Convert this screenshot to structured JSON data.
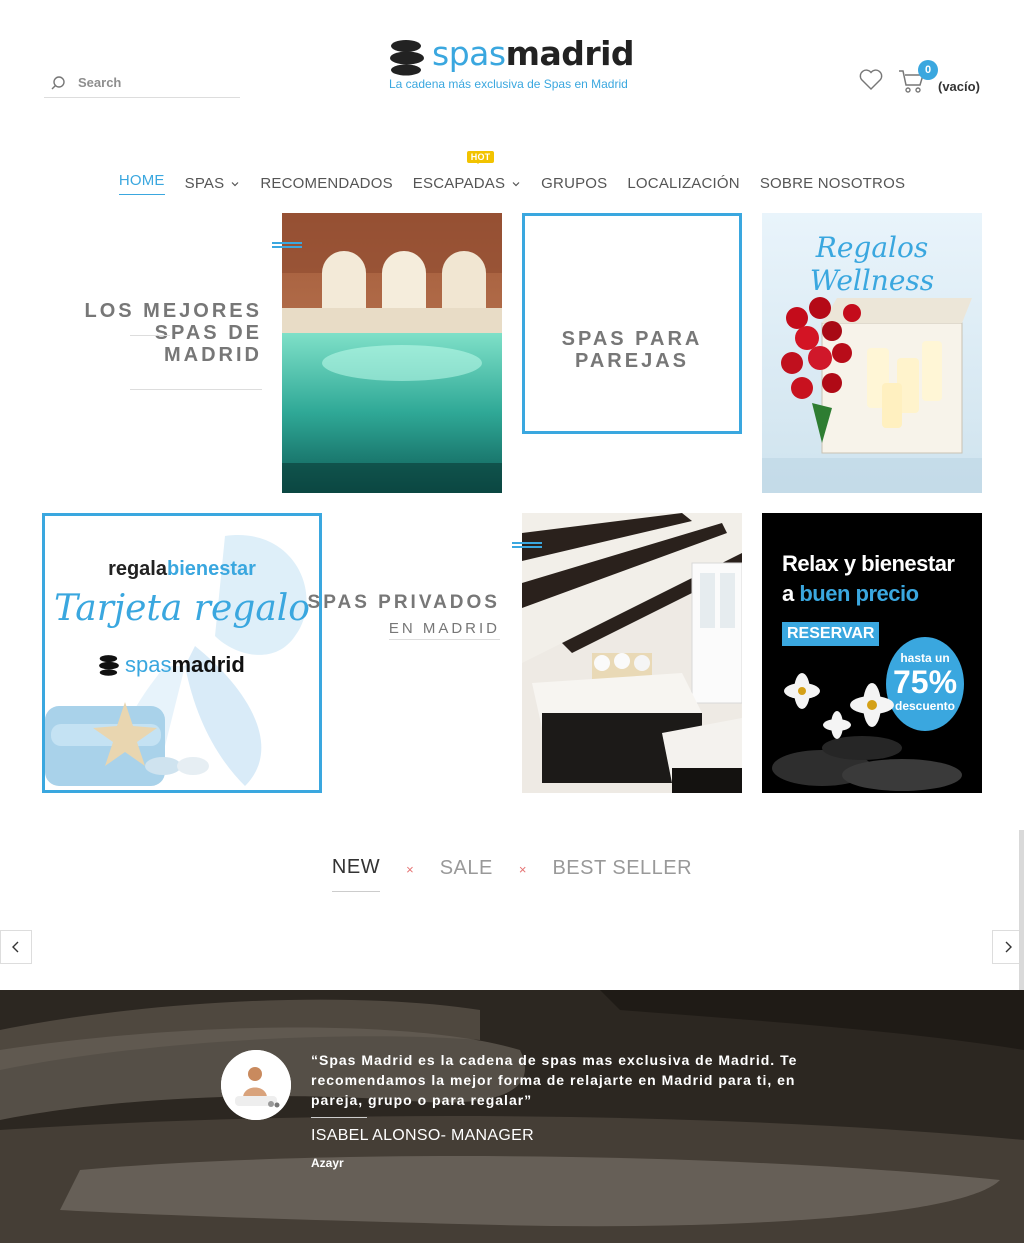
{
  "header": {
    "search_placeholder": "Search",
    "logo_part1": "spas",
    "logo_part2": "madrid",
    "tagline": "La cadena más exclusiva de Spas en Madrid",
    "cart_count": "0",
    "cart_label": "(vacío)"
  },
  "nav": {
    "items": [
      {
        "label": "HOME",
        "active": true
      },
      {
        "label": "SPAS",
        "dropdown": true
      },
      {
        "label": "RECOMENDADOS"
      },
      {
        "label": "ESCAPADAS",
        "dropdown": true,
        "badge": "HOT"
      },
      {
        "label": "GRUPOS"
      },
      {
        "label": "LOCALIZACIÓN"
      },
      {
        "label": "SOBRE NOSOTROS"
      }
    ]
  },
  "grid": {
    "best_spas_title_1": "LOS MEJORES",
    "best_spas_title_2": "SPAS DE",
    "best_spas_title_3": "MADRID",
    "couples_title_1": "SPAS PARA",
    "couples_title_2": "PAREJAS",
    "gifts_script": "Regalos Wellness",
    "giftcard_brand_1": "regala",
    "giftcard_brand_2": "bienestar",
    "giftcard_script": "Tarjeta regalo",
    "giftcard_logo_1": "spas",
    "giftcard_logo_2": "madrid",
    "private_title": "SPAS PRIVADOS",
    "private_subtitle": "EN MADRID",
    "promo_line1": "Relax y bienestar",
    "promo_line2a": "a ",
    "promo_line2b": "buen precio",
    "promo_button": "RESERVAR",
    "promo_badge_top": "hasta un",
    "promo_badge_value": "75%",
    "promo_badge_bottom": "descuento"
  },
  "tabs": {
    "items": [
      "NEW",
      "SALE",
      "BEST SELLER"
    ],
    "separator": "×"
  },
  "testimonial": {
    "quote": "“Spas Madrid es la cadena de spas mas exclusiva de Madrid. Te recomendamos la mejor forma de relajarte en Madrid para ti, en pareja, grupo o para regalar”",
    "author": "ISABEL ALONSO- MANAGER",
    "company": "Azayr"
  },
  "colors": {
    "accent": "#3aa7df",
    "hot": "#f2c300"
  }
}
